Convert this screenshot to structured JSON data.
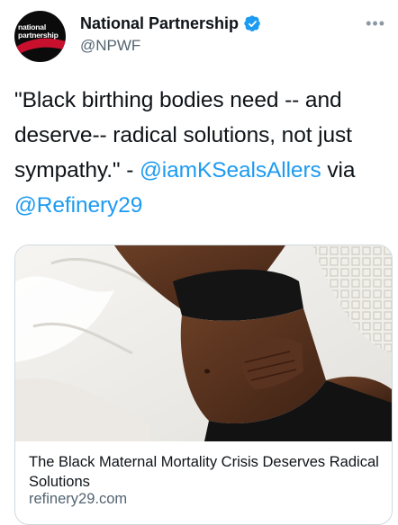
{
  "account": {
    "display_name": "National Partnership",
    "handle": "@NPWF",
    "avatar_text": [
      "national",
      "partnership"
    ],
    "verified_icon": "verified-badge-icon",
    "more_icon": "more-horizontal-icon"
  },
  "tweet": {
    "text_before": "\"Black birthing bodies need -- and deserve-- radical solutions, not just sympathy.\" - ",
    "mention_1": "@iamKSealsAllers",
    "text_between": " via ",
    "mention_2": "@Refinery29"
  },
  "link_card": {
    "title": "The Black Maternal Mortality Crisis Deserves Radical Solutions",
    "domain": "refinery29.com",
    "image_icon": "article-photo"
  },
  "colors": {
    "text": "#0f1419",
    "secondary": "#536471",
    "link": "#1d9bf0",
    "verified": "#1d9bf0",
    "brand_red": "#c8102e"
  }
}
